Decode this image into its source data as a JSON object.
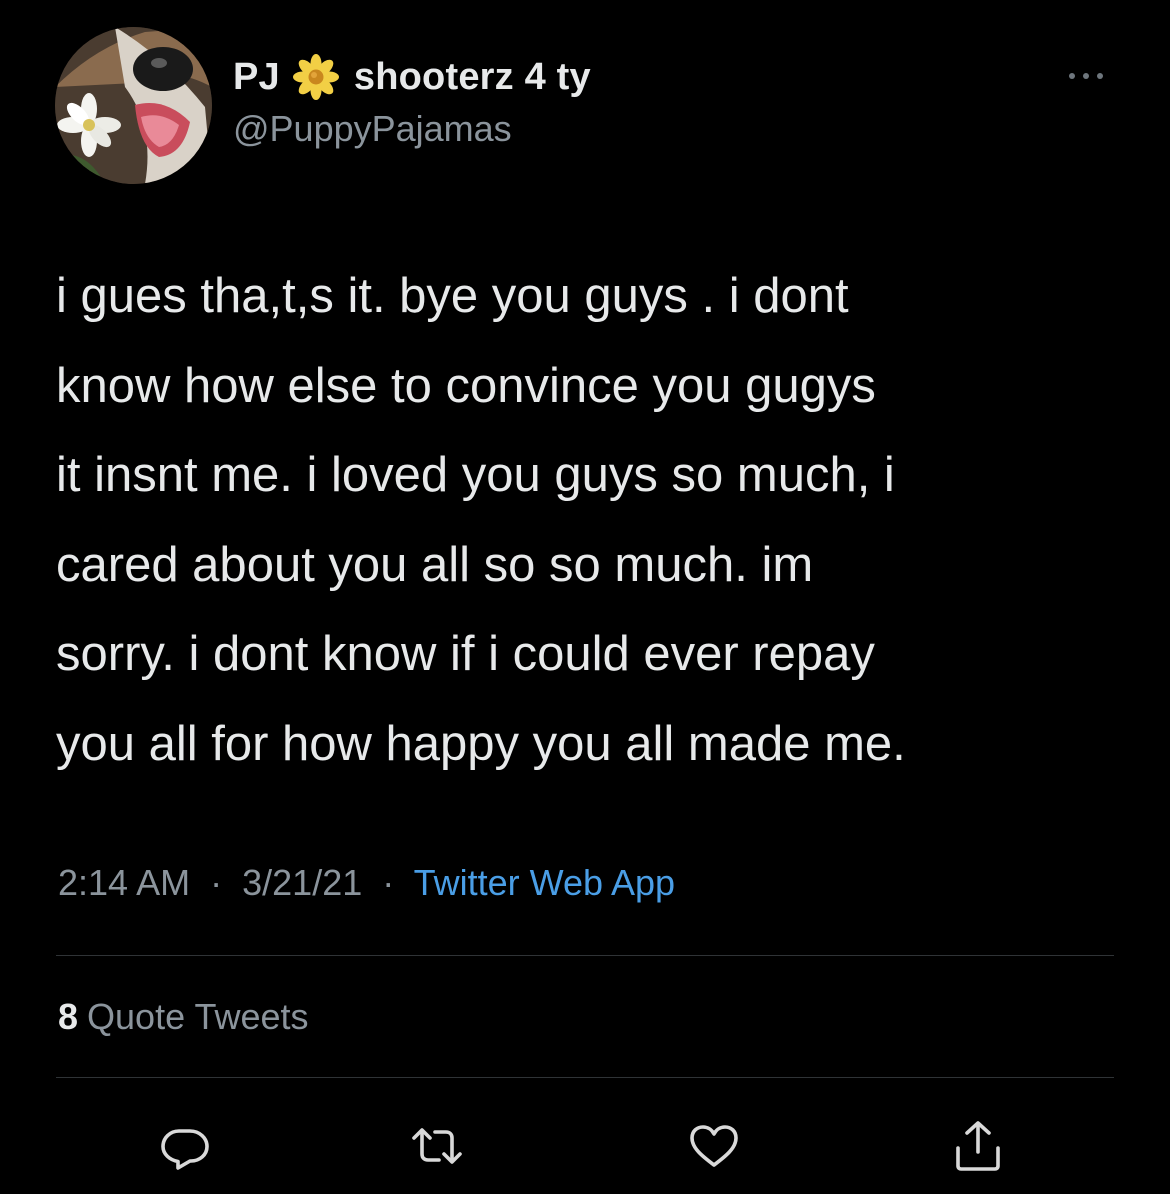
{
  "author": {
    "name_part_1": "PJ",
    "name_part_2": "shooterz 4 ty",
    "handle": "@PuppyPajamas",
    "name_emoji": "flower-icon"
  },
  "tweet": {
    "lines": [
      "i gues tha,t,s it. bye you guys . i dont",
      "know how else to convince you gugys",
      "it insnt me. i loved you guys so much, i",
      "cared about you all so so much. im",
      "sorry. i dont know if i could ever repay",
      "you all for how happy you all made me."
    ]
  },
  "meta": {
    "time": "2:14 AM",
    "separator": "·",
    "date": "3/21/21",
    "source": "Twitter Web App"
  },
  "stats": {
    "quote_count": "8",
    "quote_label": "Quote Tweets"
  },
  "actions": [
    "reply-icon",
    "retweet-icon",
    "like-icon",
    "share-icon"
  ],
  "colors": {
    "background": "#000000",
    "text": "#e7e9ea",
    "secondary": "#8b949c",
    "link": "#4a9ee6",
    "divider": "#2f3336"
  }
}
